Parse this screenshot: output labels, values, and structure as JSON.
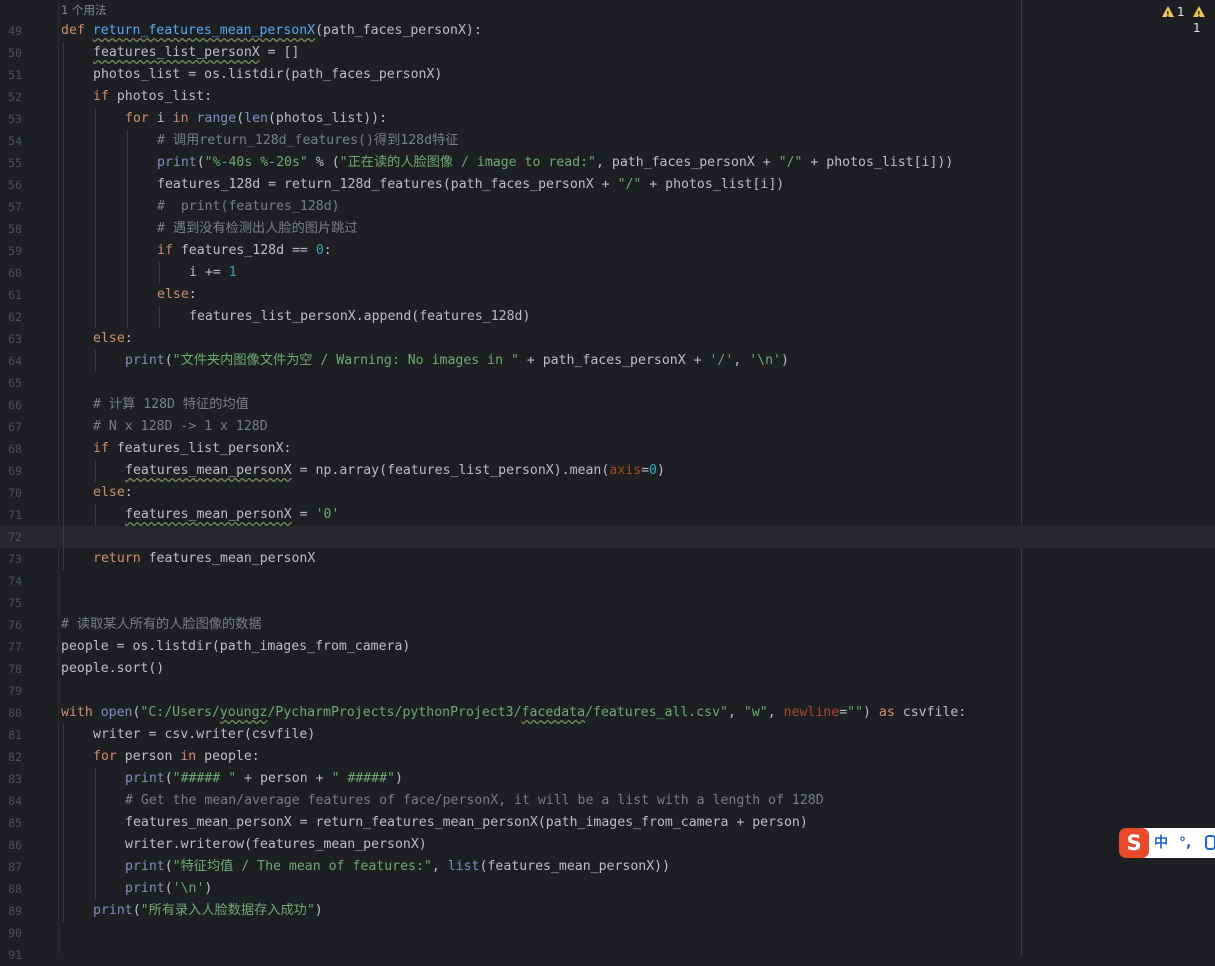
{
  "editor": {
    "usage_hint": "1 个用法",
    "inspections": [
      {
        "icon": "warning-icon",
        "count": "1"
      },
      {
        "icon": "warning-icon",
        "count": "1"
      }
    ],
    "current_line": 72,
    "lines": [
      {
        "num": 49,
        "indent": 0,
        "tokens": [
          {
            "t": "def ",
            "c": "k"
          },
          {
            "t": "return_features_mean_personX",
            "c": "fd u"
          },
          {
            "t": "(path_faces_personX):"
          }
        ]
      },
      {
        "num": 50,
        "indent": 1,
        "tokens": [
          {
            "t": "features_list_personX",
            "c": "u"
          },
          {
            "t": " = []"
          }
        ]
      },
      {
        "num": 51,
        "indent": 1,
        "tokens": [
          {
            "t": "photos_list = os.listdir(path_faces_personX)"
          }
        ]
      },
      {
        "num": 52,
        "indent": 1,
        "tokens": [
          {
            "t": "if ",
            "c": "k"
          },
          {
            "t": "photos_list:"
          }
        ]
      },
      {
        "num": 53,
        "indent": 2,
        "tokens": [
          {
            "t": "for ",
            "c": "k"
          },
          {
            "t": "i "
          },
          {
            "t": "in ",
            "c": "k"
          },
          {
            "t": "range",
            "c": "b"
          },
          {
            "t": "("
          },
          {
            "t": "len",
            "c": "b"
          },
          {
            "t": "(photos_list)):"
          }
        ]
      },
      {
        "num": 54,
        "indent": 3,
        "tokens": [
          {
            "t": "# 调用return_128d_features()得到128d特征",
            "c": "c"
          }
        ]
      },
      {
        "num": 55,
        "indent": 3,
        "tokens": [
          {
            "t": "print",
            "c": "b"
          },
          {
            "t": "("
          },
          {
            "t": "\"%-40s %-20s\"",
            "c": "s"
          },
          {
            "t": " % ("
          },
          {
            "t": "\"正在读的人脸图像 / image to read:\"",
            "c": "s"
          },
          {
            "t": ", path_faces_personX + "
          },
          {
            "t": "\"/\"",
            "c": "s"
          },
          {
            "t": " + photos_list[i]))"
          }
        ]
      },
      {
        "num": 56,
        "indent": 3,
        "tokens": [
          {
            "t": "features_128d = return_128d_features(path_faces_personX + "
          },
          {
            "t": "\"/\"",
            "c": "s"
          },
          {
            "t": " + photos_list[i])"
          }
        ]
      },
      {
        "num": 57,
        "indent": 3,
        "tokens": [
          {
            "t": "#  print(features_128d)",
            "c": "c"
          }
        ]
      },
      {
        "num": 58,
        "indent": 3,
        "tokens": [
          {
            "t": "# 遇到没有检测出人脸的图片跳过",
            "c": "c"
          }
        ]
      },
      {
        "num": 59,
        "indent": 3,
        "tokens": [
          {
            "t": "if ",
            "c": "k"
          },
          {
            "t": "features_128d == "
          },
          {
            "t": "0",
            "c": "n"
          },
          {
            "t": ":"
          }
        ]
      },
      {
        "num": 60,
        "indent": 4,
        "tokens": [
          {
            "t": "i += "
          },
          {
            "t": "1",
            "c": "n"
          }
        ]
      },
      {
        "num": 61,
        "indent": 3,
        "tokens": [
          {
            "t": "else",
            "c": "k"
          },
          {
            "t": ":"
          }
        ]
      },
      {
        "num": 62,
        "indent": 4,
        "tokens": [
          {
            "t": "features_list_personX.append(features_128d)"
          }
        ]
      },
      {
        "num": 63,
        "indent": 1,
        "tokens": [
          {
            "t": "else",
            "c": "k"
          },
          {
            "t": ":"
          }
        ]
      },
      {
        "num": 64,
        "indent": 2,
        "tokens": [
          {
            "t": "print",
            "c": "b"
          },
          {
            "t": "("
          },
          {
            "t": "\"文件夹内图像文件为空 / Warning: No images in \"",
            "c": "s"
          },
          {
            "t": " + path_faces_personX + "
          },
          {
            "t": "'/'",
            "c": "s"
          },
          {
            "t": ", "
          },
          {
            "t": "'\\n'",
            "c": "s"
          },
          {
            "t": ")"
          }
        ]
      },
      {
        "num": 65,
        "indent": 0,
        "tokens": []
      },
      {
        "num": 66,
        "indent": 1,
        "tokens": [
          {
            "t": "# 计算 128D 特征的均值",
            "c": "c"
          }
        ]
      },
      {
        "num": 67,
        "indent": 1,
        "tokens": [
          {
            "t": "# N x 128D -> 1 x 128D",
            "c": "c"
          }
        ]
      },
      {
        "num": 68,
        "indent": 1,
        "tokens": [
          {
            "t": "if ",
            "c": "k"
          },
          {
            "t": "features_list_personX:"
          }
        ]
      },
      {
        "num": 69,
        "indent": 2,
        "tokens": [
          {
            "t": "features_mean_personX",
            "c": "u"
          },
          {
            "t": " = np.array(features_list_personX).mean("
          },
          {
            "t": "axis",
            "c": "pa"
          },
          {
            "t": "="
          },
          {
            "t": "0",
            "c": "n"
          },
          {
            "t": ")"
          }
        ]
      },
      {
        "num": 70,
        "indent": 1,
        "tokens": [
          {
            "t": "else",
            "c": "k"
          },
          {
            "t": ":"
          }
        ]
      },
      {
        "num": 71,
        "indent": 2,
        "tokens": [
          {
            "t": "features_mean_personX",
            "c": "u"
          },
          {
            "t": " = "
          },
          {
            "t": "'0'",
            "c": "s"
          }
        ]
      },
      {
        "num": 72,
        "indent": 0,
        "tokens": []
      },
      {
        "num": 73,
        "indent": 1,
        "tokens": [
          {
            "t": "return ",
            "c": "k"
          },
          {
            "t": "features_mean_personX"
          }
        ]
      },
      {
        "num": 74,
        "indent": 0,
        "tokens": []
      },
      {
        "num": 75,
        "indent": 0,
        "tokens": []
      },
      {
        "num": 76,
        "indent": 0,
        "tokens": [
          {
            "t": "# 读取某人所有的人脸图像的数据",
            "c": "c"
          }
        ]
      },
      {
        "num": 77,
        "indent": 0,
        "tokens": [
          {
            "t": "people = os.listdir(path_images_from_camera)"
          }
        ]
      },
      {
        "num": 78,
        "indent": 0,
        "tokens": [
          {
            "t": "people.sort()"
          }
        ]
      },
      {
        "num": 79,
        "indent": 0,
        "tokens": []
      },
      {
        "num": 80,
        "indent": 0,
        "tokens": [
          {
            "t": "with ",
            "c": "k"
          },
          {
            "t": "open",
            "c": "b"
          },
          {
            "t": "("
          },
          {
            "t": "\"C:/Users/",
            "c": "s"
          },
          {
            "t": "youngz",
            "c": "s u"
          },
          {
            "t": "/PycharmProjects/pythonProject3/",
            "c": "s"
          },
          {
            "t": "facedata",
            "c": "s u"
          },
          {
            "t": "/features_all.csv\"",
            "c": "s"
          },
          {
            "t": ", "
          },
          {
            "t": "\"w\"",
            "c": "s"
          },
          {
            "t": ", "
          },
          {
            "t": "newline",
            "c": "pa"
          },
          {
            "t": "="
          },
          {
            "t": "\"\"",
            "c": "s"
          },
          {
            "t": ") "
          },
          {
            "t": "as ",
            "c": "k"
          },
          {
            "t": "csvfile:"
          }
        ]
      },
      {
        "num": 81,
        "indent": 1,
        "tokens": [
          {
            "t": "writer = csv.writer(csvfile)"
          }
        ]
      },
      {
        "num": 82,
        "indent": 1,
        "tokens": [
          {
            "t": "for ",
            "c": "k"
          },
          {
            "t": "person "
          },
          {
            "t": "in ",
            "c": "k"
          },
          {
            "t": "people:"
          }
        ]
      },
      {
        "num": 83,
        "indent": 2,
        "tokens": [
          {
            "t": "print",
            "c": "b"
          },
          {
            "t": "("
          },
          {
            "t": "\"##### \"",
            "c": "s"
          },
          {
            "t": " + person + "
          },
          {
            "t": "\" #####\"",
            "c": "s"
          },
          {
            "t": ")"
          }
        ]
      },
      {
        "num": 84,
        "indent": 2,
        "tokens": [
          {
            "t": "# Get the mean/average features of face/personX, it will be a list with a length of 128D",
            "c": "c"
          }
        ]
      },
      {
        "num": 85,
        "indent": 2,
        "tokens": [
          {
            "t": "features_mean_personX = return_features_mean_personX(path_images_from_camera + person)"
          }
        ]
      },
      {
        "num": 86,
        "indent": 2,
        "tokens": [
          {
            "t": "writer.writerow(features_mean_personX)"
          }
        ]
      },
      {
        "num": 87,
        "indent": 2,
        "tokens": [
          {
            "t": "print",
            "c": "b"
          },
          {
            "t": "("
          },
          {
            "t": "\"特征均值 / The mean of features:\"",
            "c": "s"
          },
          {
            "t": ", "
          },
          {
            "t": "list",
            "c": "b"
          },
          {
            "t": "(features_mean_personX))"
          }
        ]
      },
      {
        "num": 88,
        "indent": 2,
        "tokens": [
          {
            "t": "print",
            "c": "b"
          },
          {
            "t": "("
          },
          {
            "t": "'\\n'",
            "c": "s"
          },
          {
            "t": ")"
          }
        ]
      },
      {
        "num": 89,
        "indent": 1,
        "tokens": [
          {
            "t": "print",
            "c": "b"
          },
          {
            "t": "("
          },
          {
            "t": "\"所有录入人脸数据存入成功\"",
            "c": "s"
          },
          {
            "t": ")"
          }
        ]
      },
      {
        "num": 90,
        "indent": 0,
        "tokens": []
      },
      {
        "num": 91,
        "indent": 0,
        "tokens": []
      }
    ]
  },
  "ime": {
    "logo": "S",
    "lang": "中",
    "punct": "°,",
    "mic_icon": "microphone-icon"
  }
}
